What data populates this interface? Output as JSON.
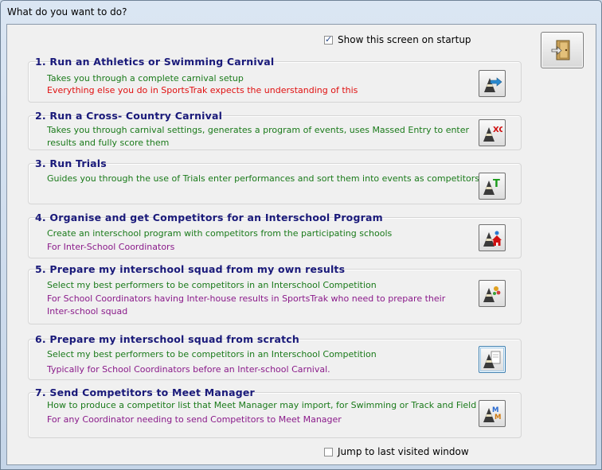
{
  "window": {
    "title": "What do you want to do?"
  },
  "startup": {
    "label": "Show this screen on startup",
    "checked": true
  },
  "jump": {
    "label": "Jump to last visited window",
    "checked": false
  },
  "options": [
    {
      "heading": "1. Run an Athletics or Swimming Carnival",
      "lines": [
        {
          "text": "Takes you through a complete carnival setup",
          "color": "green"
        },
        {
          "text": "Everything else you do in SportsTrak expects the understanding of this",
          "color": "red"
        }
      ],
      "icon": "cone-arrow-icon"
    },
    {
      "heading": "2. Run a Cross- Country Carnival",
      "lines": [
        {
          "text": "Takes you through carnival settings, generates a program of events, uses Massed Entry to enter",
          "color": "green"
        },
        {
          "text": "results and fully score them",
          "color": "green"
        }
      ],
      "icon": "cone-xc-icon"
    },
    {
      "heading": "3. Run Trials",
      "lines": [
        {
          "text": "Guides you through the use of Trials enter performances and sort them into events as competitors",
          "color": "green"
        }
      ],
      "icon": "cone-t-icon"
    },
    {
      "heading": "4. Organise and get Competitors for an Interschool Program",
      "lines": [
        {
          "text": "Create an interschool program with competitors from the participating schools",
          "color": "green"
        },
        {
          "text": "For Inter-School Coordinators",
          "color": "purple"
        }
      ],
      "icon": "cone-house-icon"
    },
    {
      "heading": "5. Prepare my interschool squad from my own results",
      "lines": [
        {
          "text": "Select my best performers to be competitors in an Interschool Competition",
          "color": "green"
        },
        {
          "text": "For School Coordinators having Inter-house results in SportsTrak who need to prepare their",
          "color": "purple"
        },
        {
          "text": "Inter-school squad",
          "color": "purple"
        }
      ],
      "icon": "cone-squad-icon"
    },
    {
      "heading": "6. Prepare my interschool squad from scratch",
      "lines": [
        {
          "text": "Select my best performers to be competitors in an Interschool Competition",
          "color": "green"
        },
        {
          "text": "Typically for School Coordinators before an Inter-school Carnival.",
          "color": "purple"
        }
      ],
      "icon": "cone-page-icon"
    },
    {
      "heading": "7. Send Competitors to Meet Manager",
      "lines": [
        {
          "text": "How to produce a competitor list that Meet Manager may import, for Swimming or Track and Field",
          "color": "green"
        },
        {
          "text": "For any Coordinator needing to send Competitors to Meet Manager",
          "color": "purple"
        }
      ],
      "icon": "cone-mm-icon"
    }
  ],
  "icon_labels": {
    "xc": "XC",
    "t": "T",
    "mm": "MM"
  }
}
